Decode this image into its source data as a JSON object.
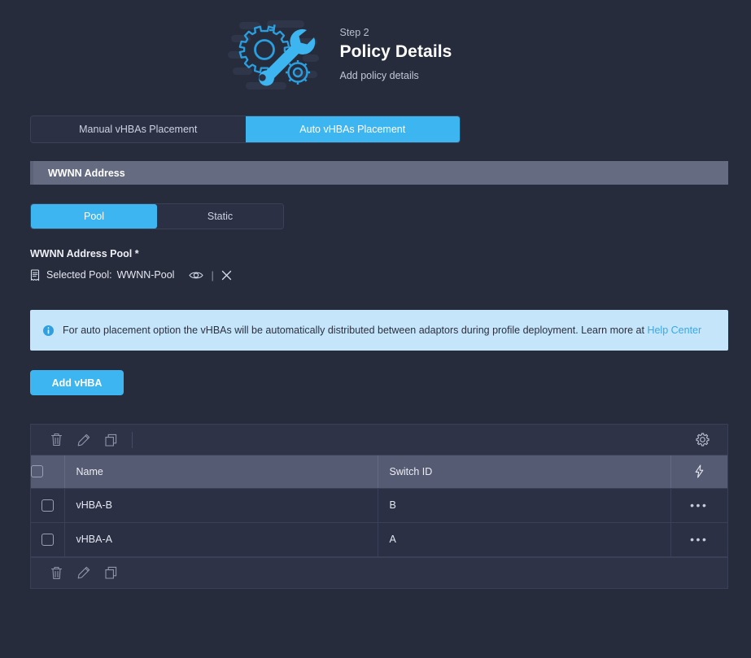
{
  "header": {
    "step_label": "Step 2",
    "title": "Policy Details",
    "subtitle": "Add policy details",
    "icon": "gear-wrench-icon"
  },
  "placement_toggle": {
    "options": [
      {
        "label": "Manual vHBAs Placement",
        "active": false
      },
      {
        "label": "Auto vHBAs Placement",
        "active": true
      }
    ]
  },
  "section": {
    "title": "WWNN Address"
  },
  "pool_toggle": {
    "options": [
      {
        "label": "Pool",
        "active": true
      },
      {
        "label": "Static",
        "active": false
      }
    ]
  },
  "pool_field": {
    "label": "WWNN Address Pool *",
    "selected_prefix": "Selected Pool:",
    "selected_value": "WWNN-Pool",
    "divider": "|",
    "doc_icon": "document-list-icon",
    "eye_icon": "eye-icon",
    "close_icon": "close-x-icon"
  },
  "info_banner": {
    "icon": "info-circle-icon",
    "text": "For auto placement option the vHBAs will be automatically distributed between adaptors during profile deployment. Learn more at ",
    "link_text": "Help Center",
    "background": "#c5e6fa",
    "link_color": "#3aa7e6"
  },
  "actions": {
    "add_vhba_label": "Add vHBA"
  },
  "table": {
    "toolbar": {
      "delete_icon": "trash-icon",
      "edit_icon": "pencil-icon",
      "clone_icon": "copy-icon",
      "settings_icon": "gear-icon"
    },
    "columns": [
      {
        "key": "name",
        "label": "Name"
      },
      {
        "key": "switch_id",
        "label": "Switch ID"
      }
    ],
    "action_column_icon": "lightning-bolt-icon",
    "row_action_icon": "ellipsis-icon",
    "rows": [
      {
        "name": "vHBA-B",
        "switch_id": "B",
        "selected": false
      },
      {
        "name": "vHBA-A",
        "switch_id": "A",
        "selected": false
      }
    ],
    "bottom_toolbar": {
      "delete_icon": "trash-icon",
      "edit_icon": "pencil-icon",
      "clone_icon": "copy-icon"
    }
  },
  "theme": {
    "accent": "#3db5f0",
    "background": "#272c3d",
    "panel": "#2b3044",
    "section_bar": "#656b81"
  }
}
